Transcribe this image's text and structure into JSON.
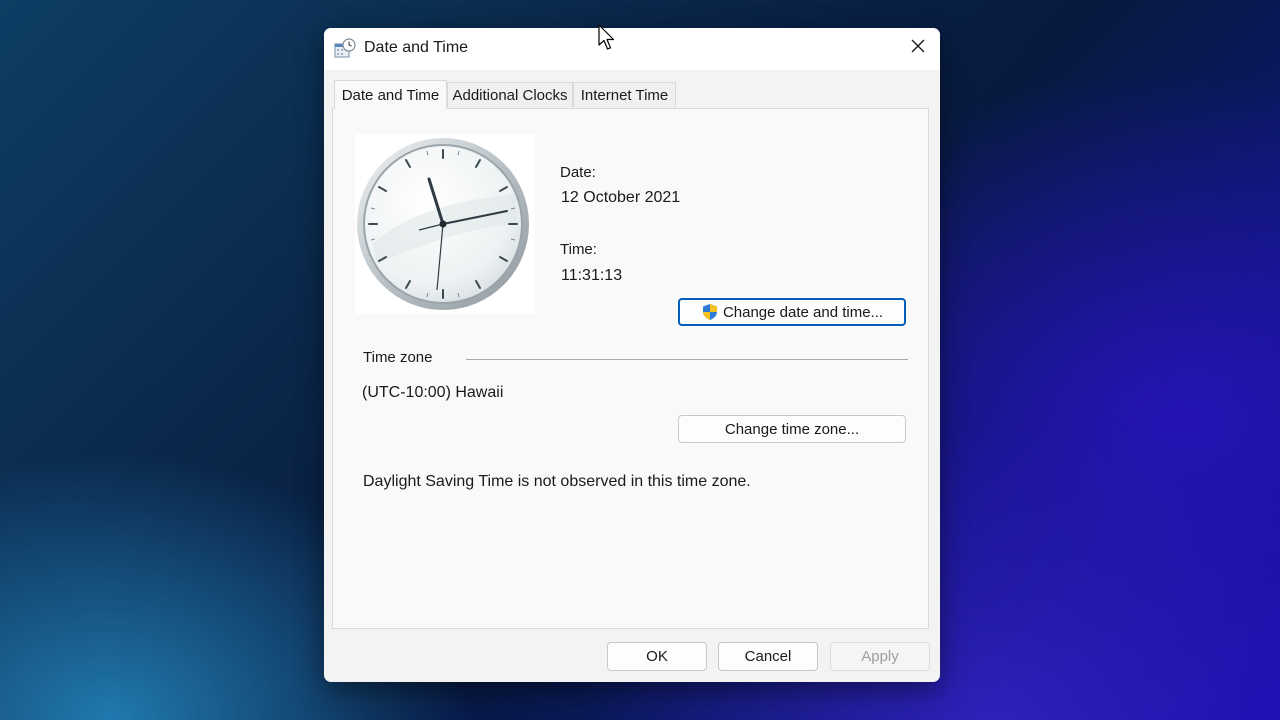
{
  "window": {
    "title": "Date and Time"
  },
  "tabs": [
    {
      "label": "Date and Time",
      "active": true
    },
    {
      "label": "Additional Clocks",
      "active": false
    },
    {
      "label": "Internet Time",
      "active": false
    }
  ],
  "datetime": {
    "date_label": "Date:",
    "date_value": "12 October 2021",
    "time_label": "Time:",
    "time_value": "11:31:13",
    "change_datetime_button": "Change date and time..."
  },
  "timezone": {
    "section_label": "Time zone",
    "value": "(UTC-10:00) Hawaii",
    "change_timezone_button": "Change time zone...",
    "dst_note": "Daylight Saving Time is not observed in this time zone."
  },
  "footer": {
    "ok_label": "OK",
    "cancel_label": "Cancel",
    "apply_label": "Apply"
  },
  "icons": {
    "title": "date-time-control-panel-icon",
    "close": "close-icon",
    "shield": "uac-shield-icon",
    "clock": "analog-clock-icon"
  },
  "colors": {
    "accent": "#005fb8",
    "dialog_bg": "#f3f3f3",
    "panel_bg": "#f9f9f9"
  }
}
